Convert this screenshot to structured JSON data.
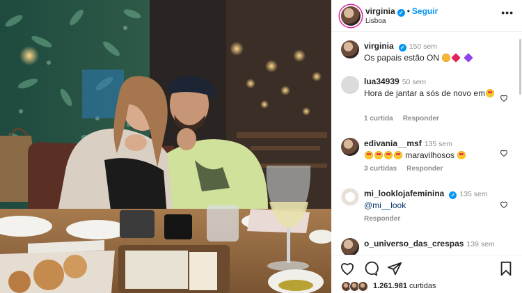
{
  "post": {
    "username": "virginia",
    "follow_label": "Seguir",
    "location": "Lisboa",
    "more_label": "•••"
  },
  "caption": {
    "username": "virginia",
    "time": "150 sem",
    "text": "Os papais estão ON"
  },
  "comments": [
    {
      "username": "lua34939",
      "time": "50 sem",
      "text": "Hora de jantar a sós de novo em",
      "likes": "1 curtida",
      "reply": "Responder"
    },
    {
      "username": "edivania__msf",
      "time": "135 sem",
      "text": "maravilhosos",
      "likes": "3 curtidas",
      "reply": "Responder"
    },
    {
      "username": "mi_lookloja​feminina",
      "time": "135 sem",
      "text": "@mi__look",
      "likes": "",
      "reply": "Responder"
    },
    {
      "username": "o_universo_das_crespas",
      "time": "139 sem",
      "text": "",
      "likes": "",
      "reply": ""
    }
  ],
  "actions": {
    "likes_count": "1.261.981",
    "likes_label": "curtidas"
  },
  "colors": {
    "link_blue": "#0095f6",
    "text": "#262626",
    "muted": "#8e8e8e"
  }
}
